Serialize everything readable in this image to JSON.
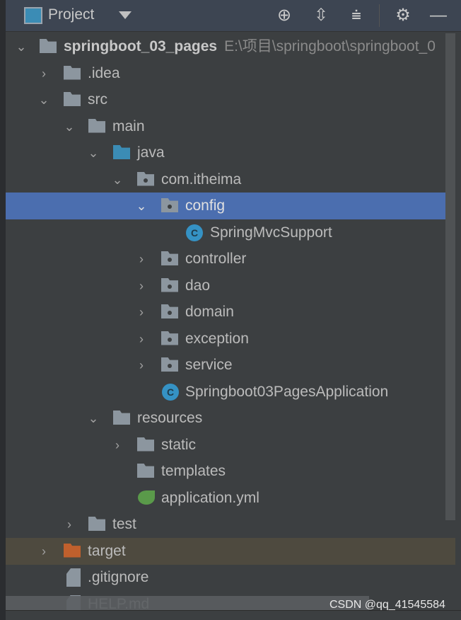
{
  "header": {
    "title": "Project",
    "icons": [
      "locate-icon",
      "expand-all-icon",
      "collapse-all-icon",
      "gear-icon",
      "minimize-icon"
    ]
  },
  "tree": {
    "root": {
      "name": "springboot_03_pages",
      "path": "E:\\项目\\springboot\\springboot_0"
    },
    "items": {
      "idea": ".idea",
      "src": "src",
      "main": "main",
      "java": "java",
      "pkg": "com.itheima",
      "config": "config",
      "springmvc": "SpringMvcSupport",
      "controller": "controller",
      "dao": "dao",
      "domain": "domain",
      "exception": "exception",
      "service": "service",
      "app": "Springboot03PagesApplication",
      "resources": "resources",
      "static": "static",
      "templates": "templates",
      "yml": "application.yml",
      "test": "test",
      "target": "target",
      "gitignore": ".gitignore",
      "help": "HELP.md"
    },
    "class_icon_letter": "C"
  },
  "watermark": "CSDN @qq_41545584",
  "colors": {
    "selected": "#4b6eaf",
    "excluded": "#4e4a3f",
    "source_folder": "#3b8cb5",
    "target_folder": "#c0602d"
  }
}
